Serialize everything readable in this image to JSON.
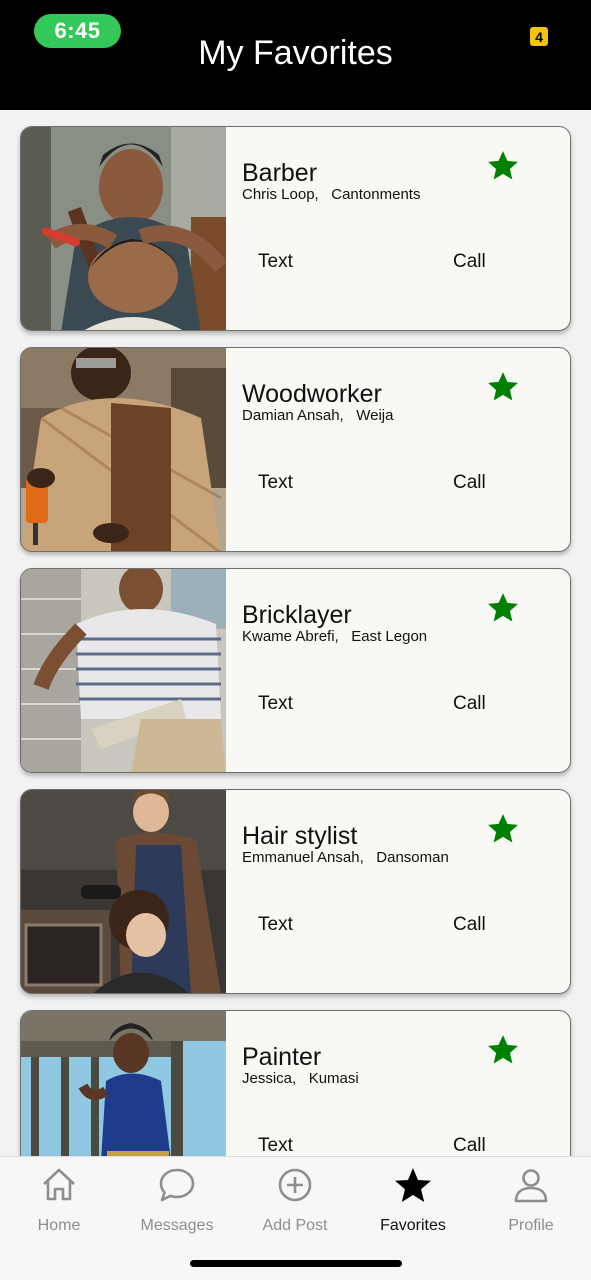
{
  "status_bar": {
    "time": "6:45",
    "badge": "4"
  },
  "header": {
    "title": "My Favorites"
  },
  "favorites": [
    {
      "title": "Barber",
      "name": "Chris Loop,",
      "location": "Cantonments",
      "text_label": "Text",
      "call_label": "Call",
      "favorited": true
    },
    {
      "title": "Woodworker",
      "name": "Damian Ansah,",
      "location": "Weija",
      "text_label": "Text",
      "call_label": "Call",
      "favorited": true
    },
    {
      "title": "Bricklayer",
      "name": "Kwame Abrefi,",
      "location": "East Legon",
      "text_label": "Text",
      "call_label": "Call",
      "favorited": true
    },
    {
      "title": "Hair stylist",
      "name": "Emmanuel Ansah,",
      "location": "Dansoman",
      "text_label": "Text",
      "call_label": "Call",
      "favorited": true
    },
    {
      "title": "Painter",
      "name": "Jessica,",
      "location": "Kumasi",
      "text_label": "Text",
      "call_label": "Call",
      "favorited": true
    }
  ],
  "tabbar": {
    "items": [
      {
        "label": "Home",
        "icon": "home-icon",
        "active": false
      },
      {
        "label": "Messages",
        "icon": "chat-bubble-icon",
        "active": false
      },
      {
        "label": "Add Post",
        "icon": "plus-circle-icon",
        "active": false
      },
      {
        "label": "Favorites",
        "icon": "star-icon",
        "active": true
      },
      {
        "label": "Profile",
        "icon": "user-icon",
        "active": false
      }
    ]
  },
  "colors": {
    "accent_green": "#008000",
    "status_green": "#34c759",
    "header_bg": "#000000",
    "badge_yellow": "#f2c40f"
  }
}
